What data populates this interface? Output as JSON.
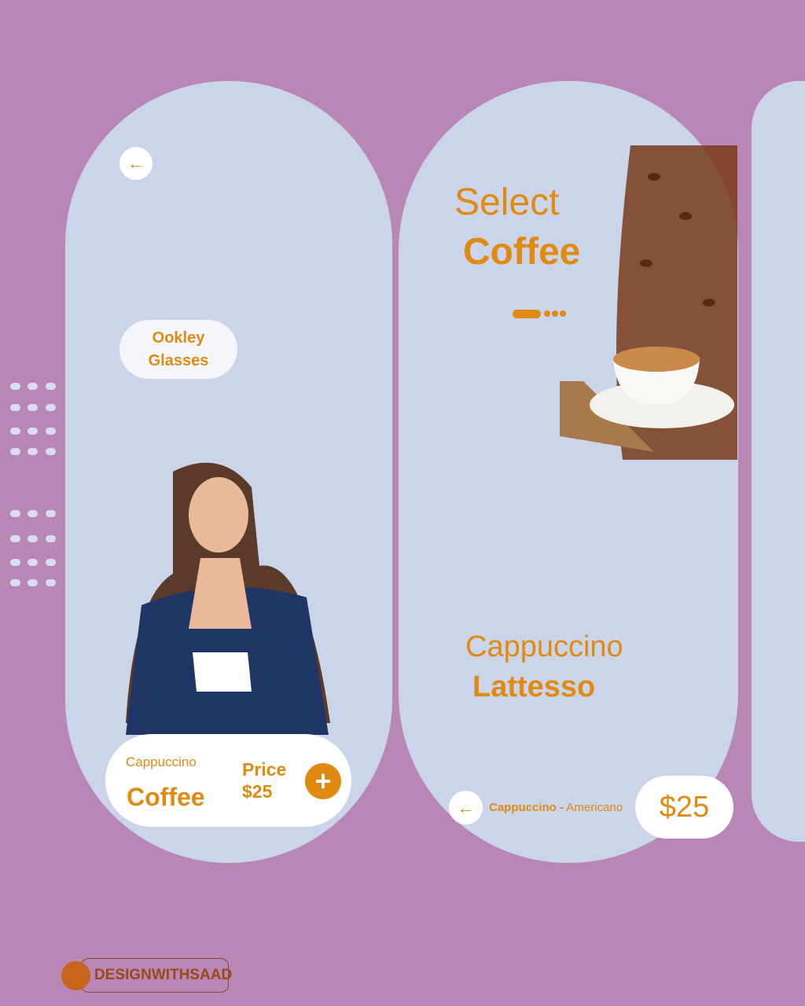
{
  "left_card": {
    "tag_line1": "Ookley",
    "tag_line2": "Glasses",
    "product_sub": "Cappuccino",
    "product_name": "Coffee",
    "price_label": "Price",
    "price": "$25"
  },
  "right_card": {
    "title_line1": "Select",
    "title_line2": "Coffee",
    "item_line1": "Cappuccino",
    "item_line2": "Lattesso",
    "crumb_active": "Cappuccino",
    "crumb_sep": "-",
    "crumb_other": "Americano",
    "price": "$25"
  },
  "brand": {
    "name": "DESIGNWITHSAAD"
  },
  "colors": {
    "accent": "#e08a12",
    "background": "#b887b5",
    "card": "#cbd5e9"
  }
}
